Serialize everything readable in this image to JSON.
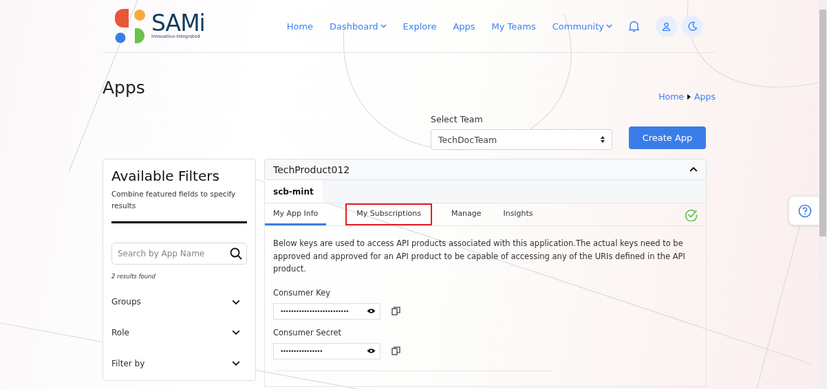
{
  "brand": {
    "name": "SAMi",
    "tagline": "Innovative-Integrated"
  },
  "nav": [
    {
      "label": "Home",
      "dropdown": false
    },
    {
      "label": "Dashboard",
      "dropdown": true
    },
    {
      "label": "Explore",
      "dropdown": false
    },
    {
      "label": "Apps",
      "dropdown": false
    },
    {
      "label": "My Teams",
      "dropdown": false
    },
    {
      "label": "Community",
      "dropdown": true
    }
  ],
  "page_title": "Apps",
  "breadcrumb": [
    "Home",
    "Apps"
  ],
  "team_select": {
    "label": "Select Team",
    "value": "TechDocTeam"
  },
  "create_button": "Create App",
  "filters": {
    "title": "Available Filters",
    "subtitle": "Combine featured fields to specify results",
    "search_placeholder": "Search by App Name",
    "results": "2 results found",
    "groups": [
      {
        "label": "Groups",
        "expanded": false
      },
      {
        "label": "Role",
        "expanded": false
      },
      {
        "label": "Filter by",
        "expanded": false
      }
    ]
  },
  "app": {
    "name": "TechProduct012",
    "expanded": true,
    "env_tab": "scb-mint",
    "tabs": [
      {
        "label": "My App Info",
        "selected": true,
        "highlighted": false
      },
      {
        "label": "My Subscriptions",
        "selected": false,
        "highlighted": true
      },
      {
        "label": "Manage",
        "selected": false,
        "highlighted": false
      },
      {
        "label": "Insights",
        "selected": false,
        "highlighted": false
      }
    ],
    "approved": true,
    "description": "Below keys are used to access API products associated with this application.The actual keys need to be approved and approved for an API product to be capable of accessing any of the URIs defined in the API product.",
    "keys": [
      {
        "label": "Consumer Key",
        "value": "••••••••••••••••••••••••••"
      },
      {
        "label": "Consumer Secret",
        "value": "••••••••••••••••"
      }
    ]
  }
}
